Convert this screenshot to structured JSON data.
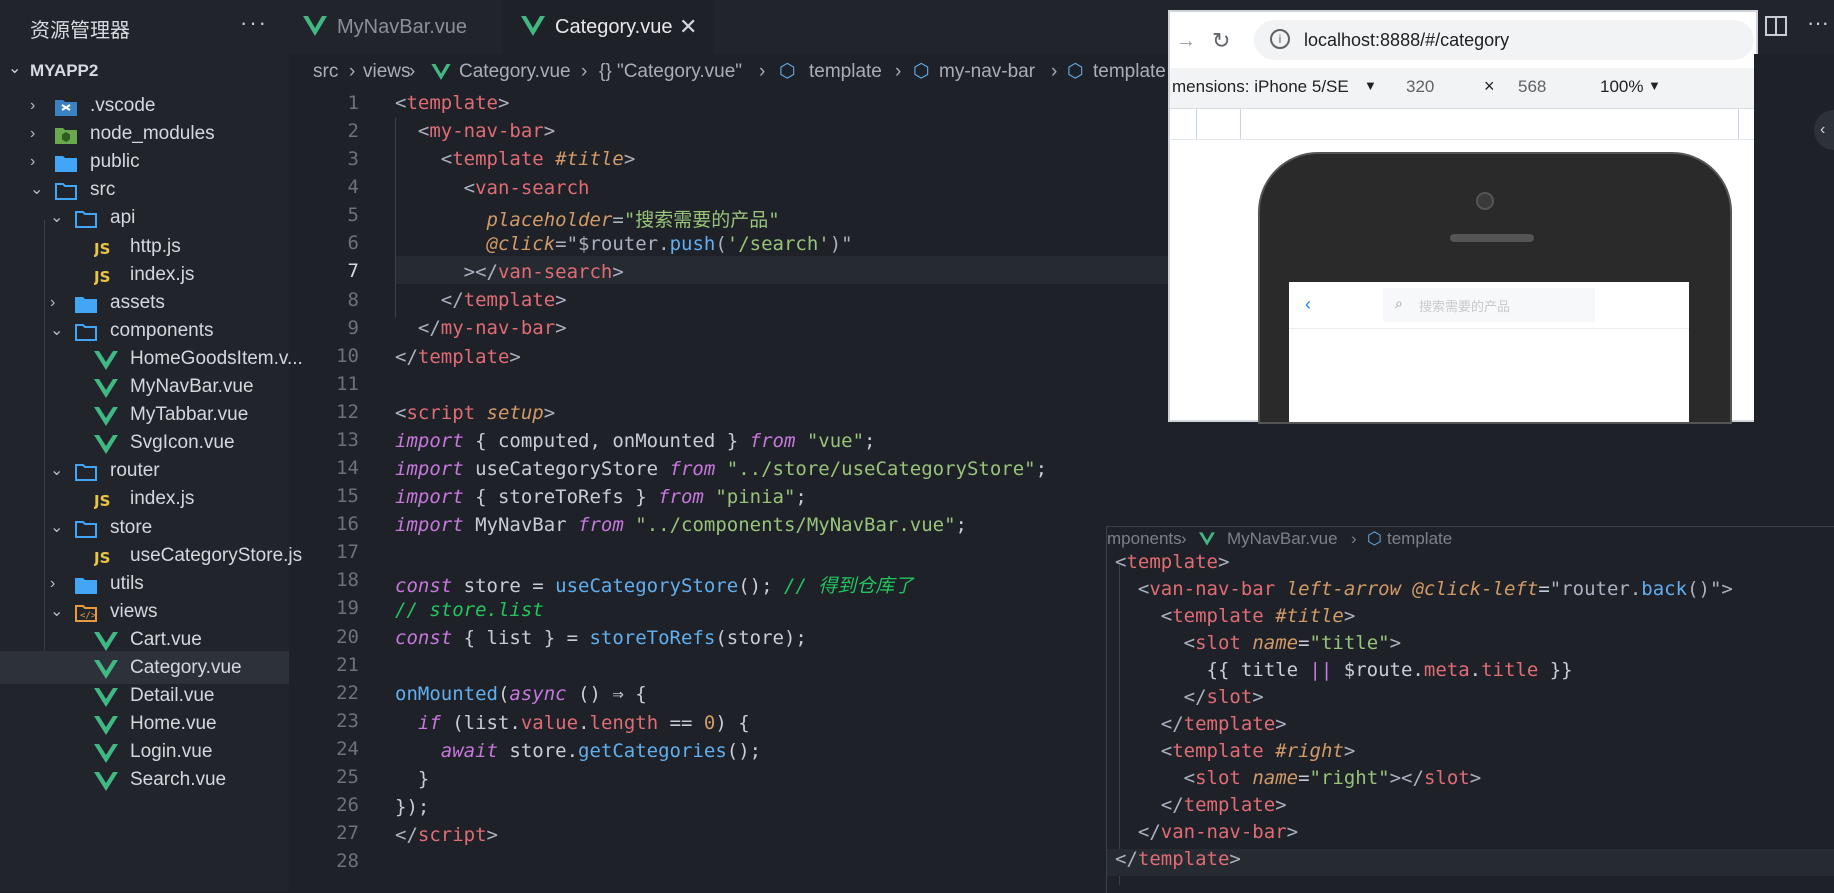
{
  "explorer": {
    "title": "资源管理器",
    "more": "···",
    "project": "MYAPP2",
    "items": [
      {
        "label": ".vscode",
        "type": "folder"
      },
      {
        "label": "node_modules",
        "type": "folder"
      },
      {
        "label": "public",
        "type": "folder"
      },
      {
        "label": "src",
        "type": "folder"
      },
      {
        "label": "api",
        "type": "folder"
      },
      {
        "label": "http.js",
        "type": "file"
      },
      {
        "label": "index.js",
        "type": "file"
      },
      {
        "label": "assets",
        "type": "folder"
      },
      {
        "label": "components",
        "type": "folder"
      },
      {
        "label": "HomeGoodsItem.v...",
        "type": "file"
      },
      {
        "label": "MyNavBar.vue",
        "type": "file"
      },
      {
        "label": "MyTabbar.vue",
        "type": "file"
      },
      {
        "label": "SvgIcon.vue",
        "type": "file"
      },
      {
        "label": "router",
        "type": "folder"
      },
      {
        "label": "index.js",
        "type": "file"
      },
      {
        "label": "store",
        "type": "folder"
      },
      {
        "label": "useCategoryStore.js",
        "type": "file"
      },
      {
        "label": "utils",
        "type": "folder"
      },
      {
        "label": "views",
        "type": "folder"
      },
      {
        "label": "Cart.vue",
        "type": "file"
      },
      {
        "label": "Category.vue",
        "type": "file"
      },
      {
        "label": "Detail.vue",
        "type": "file"
      },
      {
        "label": "Home.vue",
        "type": "file"
      },
      {
        "label": "Login.vue",
        "type": "file"
      },
      {
        "label": "Search.vue",
        "type": "file"
      }
    ]
  },
  "tabs": [
    {
      "label": "MyNavBar.vue",
      "active": false
    },
    {
      "label": "Category.vue",
      "active": true
    }
  ],
  "breadcrumb": [
    "src",
    "views",
    "Category.vue",
    "{} \"Category.vue\"",
    "template",
    "my-nav-bar",
    "template"
  ],
  "line_numbers": [
    "1",
    "2",
    "3",
    "4",
    "5",
    "6",
    "7",
    "8",
    "9",
    "10",
    "11",
    "12",
    "13",
    "14",
    "15",
    "16",
    "17",
    "18",
    "19",
    "20",
    "21",
    "22",
    "23",
    "24",
    "25",
    "26",
    "27",
    "28"
  ],
  "code": {
    "l5_value": "搜索需要的产品",
    "l13": "import { computed, onMounted } from \"vue\";",
    "l18_comment": "// 得到仓库了",
    "l19": "// store.list"
  },
  "browser": {
    "url": "localhost:8888/#/category",
    "dimensions_label": "mensions: iPhone 5/SE",
    "width": "320",
    "times": "×",
    "height": "568",
    "zoom": "100%",
    "search_placeholder": "搜索需要的产品"
  },
  "peek": {
    "breadcrumb": [
      "mponents",
      "MyNavBar.vue",
      "template"
    ],
    "lines": [
      "<template>",
      "  <van-nav-bar left-arrow @click-left=\"router.back()\">",
      "    <template #title>",
      "      <slot name=\"title\">",
      "        {{ title || $route.meta.title }}",
      "      </slot>",
      "    </template>",
      "    <template #right>",
      "      <slot name=\"right\"></slot>",
      "    </template>",
      "  </van-nav-bar>",
      "</template>"
    ]
  },
  "colors": {
    "vue_green": "#41b883",
    "folder_blue": "#42a5f5",
    "js_yellow": "#e8c547"
  }
}
